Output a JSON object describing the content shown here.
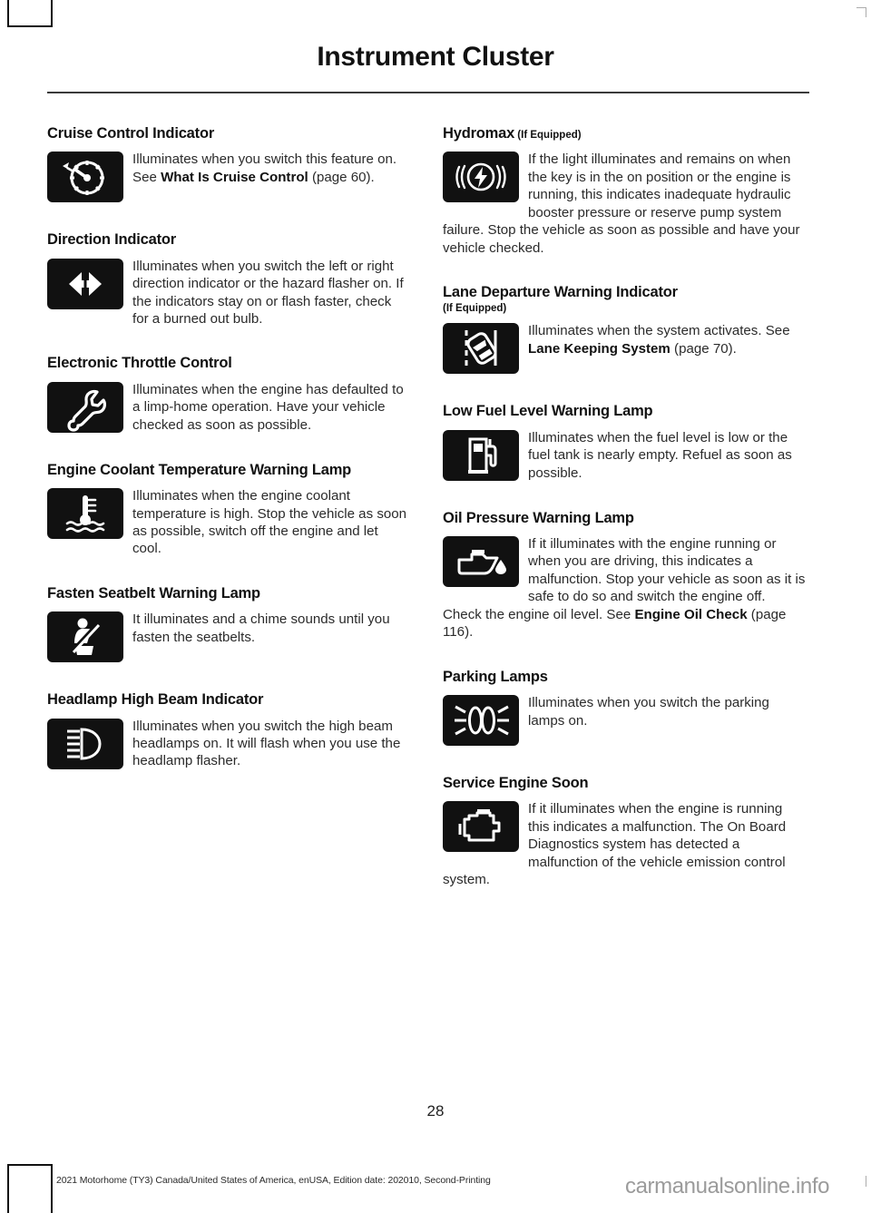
{
  "page": {
    "title": "Instrument Cluster",
    "number": "28",
    "footer_note": "2021 Motorhome (TY3) Canada/United States of America, enUSA, Edition date: 202010, Second-Printing",
    "watermark": "carmanualsonline.info"
  },
  "left_column": {
    "sections": [
      {
        "heading": "Cruise Control Indicator",
        "icon": "speedometer-icon",
        "body_lead": "Illuminates when you switch this feature on.  See ",
        "body_bold": "What Is Cruise Control",
        "body_tail": " (page 60)."
      },
      {
        "heading": "Direction Indicator",
        "icon": "turn-signal-arrows-icon",
        "body": "Illuminates when you switch the left or right direction indicator or the hazard flasher on. If the indicators stay on or flash faster, check for a burned out bulb."
      },
      {
        "heading": "Electronic Throttle Control",
        "icon": "wrench-icon",
        "body": "Illuminates when the engine has defaulted to a limp-home operation. Have your vehicle checked as soon as possible."
      },
      {
        "heading": "Engine Coolant Temperature Warning Lamp",
        "icon": "coolant-thermometer-icon",
        "body": "Illuminates when the engine coolant temperature is high. Stop the vehicle as soon as possible, switch off the engine and let cool."
      },
      {
        "heading": "Fasten Seatbelt Warning Lamp",
        "icon": "seatbelt-icon",
        "body": "It illuminates and a chime sounds until you fasten the seatbelts."
      },
      {
        "heading": "Headlamp High Beam Indicator",
        "icon": "high-beam-icon",
        "body": "Illuminates when you switch the high beam headlamps on. It will flash when you use the headlamp flasher."
      }
    ]
  },
  "right_column": {
    "sections": [
      {
        "heading": "Hydromax",
        "heading_note": " (If Equipped)",
        "icon": "brake-warning-icon",
        "body": "If the light illuminates and remains on when the key is in the on position or the engine is running, this indicates inadequate hydraulic booster pressure or reserve pump system failure. Stop the vehicle as soon as possible and have your vehicle checked."
      },
      {
        "heading": "Lane Departure Warning Indicator",
        "heading_subline": "(If Equipped)",
        "icon": "lane-departure-icon",
        "body_lead": "Illuminates when the system activates.  See ",
        "body_bold": "Lane Keeping System",
        "body_tail": " (page 70)."
      },
      {
        "heading": "Low Fuel Level Warning Lamp",
        "icon": "fuel-pump-icon",
        "body": "Illuminates when the fuel level is low or the fuel tank is nearly empty.  Refuel as soon as possible."
      },
      {
        "heading": "Oil Pressure Warning Lamp",
        "icon": "oil-can-icon",
        "body_lead": "If it illuminates with the engine running or when you are driving, this indicates a malfunction. Stop your vehicle as soon as it is safe to do so and switch the engine off.  Check the engine oil level.   See ",
        "body_bold": "Engine Oil Check",
        "body_tail": " (page 116)."
      },
      {
        "heading": "Parking Lamps",
        "icon": "parking-lamps-icon",
        "body": "Illuminates when you switch the parking lamps on."
      },
      {
        "heading": "Service Engine Soon",
        "icon": "check-engine-icon",
        "body": "If it illuminates when the engine is running this indicates a malfunction.  The On Board Diagnostics system has detected a malfunction of the vehicle emission control system."
      }
    ]
  }
}
